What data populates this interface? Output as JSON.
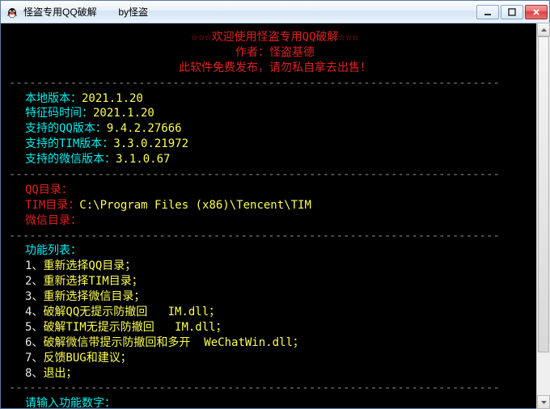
{
  "window": {
    "title": "怪盗专用QQ破解        by怪盗"
  },
  "header": {
    "line1": "☆☆☆欢迎使用怪盗专用QQ破解☆☆☆",
    "line2": "作者：怪盗基德",
    "line3": "此软件免费发布，请勿私自拿去出售！"
  },
  "separator": "------------------------------------------------------------------------",
  "version": {
    "local_label": "本地版本：",
    "local_value": "2021.1.20",
    "sig_label": "特征码时间：",
    "sig_value": "2021.1.20",
    "qq_label": "支持的QQ版本：",
    "qq_value": "9.4.2.27666",
    "tim_label": "支持的TIM版本：",
    "tim_value": "3.3.0.21972",
    "wechat_label": "支持的微信版本：",
    "wechat_value": "3.1.0.67"
  },
  "dirs": {
    "qq_label": "QQ目录：",
    "qq_value": "",
    "tim_label": "TIM目录：",
    "tim_value": "C:\\Program Files (x86)\\Tencent\\TIM",
    "wechat_label": "微信目录：",
    "wechat_value": ""
  },
  "menu": {
    "title": "功能列表：",
    "items": [
      {
        "num": "1、",
        "label": "重新选择QQ目录；",
        "extra": ""
      },
      {
        "num": "2、",
        "label": "重新选择TIM目录；",
        "extra": ""
      },
      {
        "num": "3、",
        "label": "重新选择微信目录；",
        "extra": ""
      },
      {
        "num": "4、",
        "label": "破解QQ无提示防撤回",
        "extra": "   IM.dll；"
      },
      {
        "num": "5、",
        "label": "破解TIM无提示防撤回",
        "extra": "   IM.dll；"
      },
      {
        "num": "6、",
        "label": "破解微信带提示防撤回和多开",
        "extra": "  WeChatWin.dll；"
      },
      {
        "num": "7、",
        "label": "反馈BUG和建议；",
        "extra": ""
      },
      {
        "num": "8、",
        "label": "退出；",
        "extra": ""
      }
    ]
  },
  "prompt": "请输入功能数字："
}
